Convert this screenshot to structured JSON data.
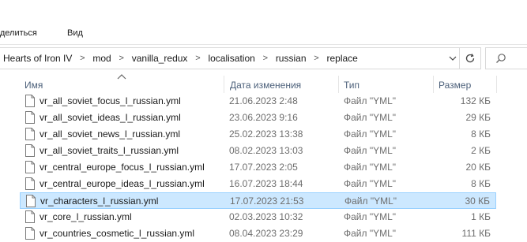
{
  "ribbon": {
    "tab_share": "оделиться",
    "tab_view": "Вид"
  },
  "address": {
    "crumbs": [
      "Hearts of Iron IV",
      "mod",
      "vanilla_redux",
      "localisation",
      "russian",
      "replace"
    ],
    "separator": ">"
  },
  "icons": {
    "dropdown": "chevron-down-icon",
    "refresh": "refresh-icon",
    "search": "search-icon",
    "file": "file-icon",
    "sort": "sort-ascending-icon"
  },
  "columns": {
    "name": "Имя",
    "date": "Дата изменения",
    "type": "Тип",
    "size": "Размер"
  },
  "files": [
    {
      "name": "vr_all_soviet_focus_l_russian.yml",
      "date": "21.06.2023 2:48",
      "type": "Файл \"YML\"",
      "size": "132 КБ",
      "selected": false
    },
    {
      "name": "vr_all_soviet_ideas_l_russian.yml",
      "date": "23.06.2023 9:16",
      "type": "Файл \"YML\"",
      "size": "29 КБ",
      "selected": false
    },
    {
      "name": "vr_all_soviet_news_l_russian.yml",
      "date": "25.02.2023 13:38",
      "type": "Файл \"YML\"",
      "size": "8 КБ",
      "selected": false
    },
    {
      "name": "vr_all_soviet_traits_l_russian.yml",
      "date": "08.02.2023 13:03",
      "type": "Файл \"YML\"",
      "size": "2 КБ",
      "selected": false
    },
    {
      "name": "vr_central_europe_focus_l_russian.yml",
      "date": "17.07.2023 2:05",
      "type": "Файл \"YML\"",
      "size": "20 КБ",
      "selected": false
    },
    {
      "name": "vr_central_europe_ideas_l_russian.yml",
      "date": "16.07.2023 18:44",
      "type": "Файл \"YML\"",
      "size": "8 КБ",
      "selected": false
    },
    {
      "name": "vr_characters_l_russian.yml",
      "date": "17.07.2023 21:53",
      "type": "Файл \"YML\"",
      "size": "30 КБ",
      "selected": true
    },
    {
      "name": "vr_core_l_russian.yml",
      "date": "02.03.2023 10:32",
      "type": "Файл \"YML\"",
      "size": "1 КБ",
      "selected": false
    },
    {
      "name": "vr_countries_cosmetic_l_russian.yml",
      "date": "08.04.2023 23:29",
      "type": "Файл \"YML\"",
      "size": "111 КБ",
      "selected": false
    }
  ],
  "colors": {
    "selection_bg": "#cce8ff",
    "selection_border": "#99d1ff",
    "header_text": "#4c607a",
    "secondary_text": "#6d6d6d"
  }
}
